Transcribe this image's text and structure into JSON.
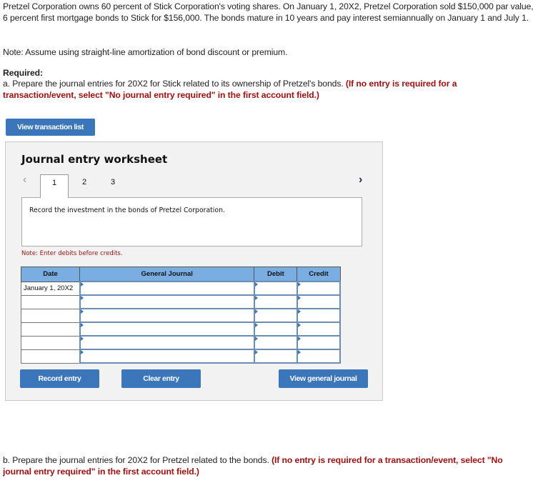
{
  "question": {
    "intro": "Pretzel Corporation owns 60 percent of Stick Corporation's voting shares. On January 1, 20X2, Pretzel Corporation sold $150,000 par value, 6 percent first mortgage bonds to Stick for $156,000. The bonds mature in 10 years and pay interest semiannually on January 1 and July 1.",
    "note": "Note: Assume using straight-line amortization of bond discount or premium.",
    "required_label": "Required:",
    "part_a_text": "a. Prepare the journal entries for 20X2 for Stick related to its ownership of Pretzel's bonds. ",
    "part_a_instruction": "(If no entry is required for a transaction/event, select \"No journal entry required\" in the first account field.)",
    "part_b_text": "b. Prepare the journal entries for 20X2 for Pretzel related to the bonds. ",
    "part_b_instruction": "(If no entry is required for a transaction/event, select \"No journal entry required\" in the first account field.)"
  },
  "buttons": {
    "view_transaction_list": "View transaction list",
    "record_entry": "Record entry",
    "clear_entry": "Clear entry",
    "view_general_journal": "View general journal"
  },
  "worksheet": {
    "title": "Journal entry worksheet",
    "prev_icon": "‹",
    "next_icon": "›",
    "tabs": [
      {
        "label": "1",
        "active": true
      },
      {
        "label": "2",
        "active": false
      },
      {
        "label": "3",
        "active": false
      }
    ],
    "instruction": "Record the investment in the bonds of Pretzel Corporation.",
    "debit_note": "Note: Enter debits before credits.",
    "table": {
      "headers": [
        "Date",
        "General Journal",
        "Debit",
        "Credit"
      ],
      "rows": [
        {
          "date": "January 1, 20X2",
          "account": "",
          "debit": "",
          "credit": ""
        },
        {
          "date": "",
          "account": "",
          "debit": "",
          "credit": ""
        },
        {
          "date": "",
          "account": "",
          "debit": "",
          "credit": ""
        },
        {
          "date": "",
          "account": "",
          "debit": "",
          "credit": ""
        },
        {
          "date": "",
          "account": "",
          "debit": "",
          "credit": ""
        },
        {
          "date": "",
          "account": "",
          "debit": "",
          "credit": ""
        }
      ]
    }
  },
  "colors": {
    "button_blue": "#3a76b9",
    "header_blue": "#7aaee2",
    "instruction_red": "#a01010"
  }
}
